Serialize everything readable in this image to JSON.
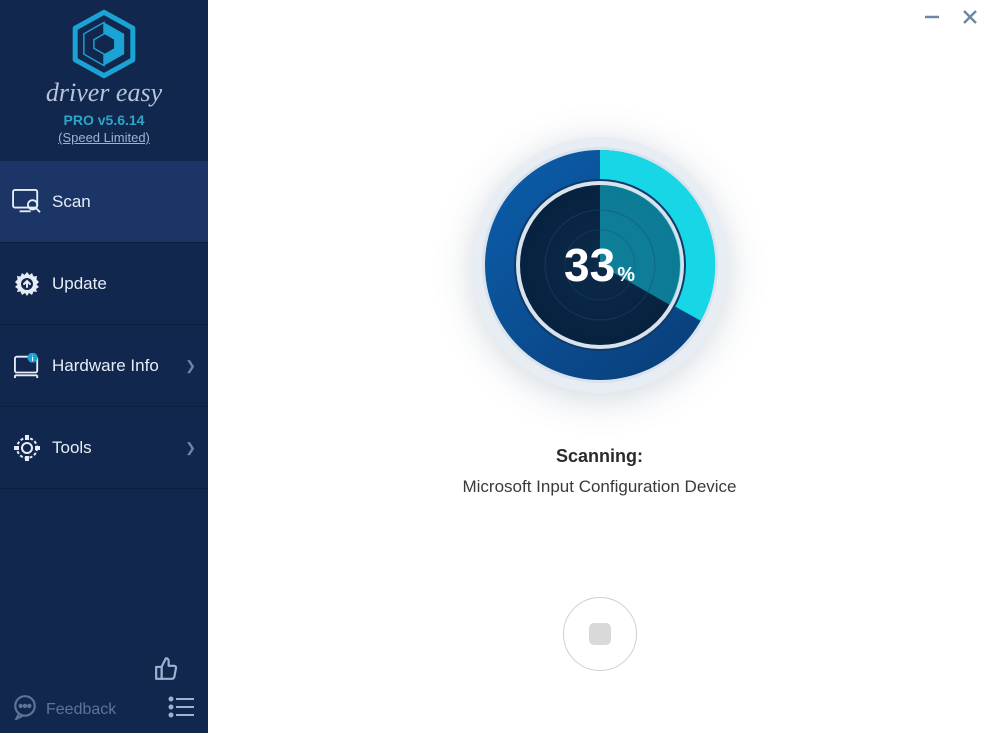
{
  "brand": "driver easy",
  "version": "PRO v5.6.14",
  "speed_limited": "(Speed Limited)",
  "nav": {
    "scan": "Scan",
    "update": "Update",
    "hardware_info": "Hardware Info",
    "tools": "Tools"
  },
  "footer": {
    "feedback": "Feedback"
  },
  "scan": {
    "progress_value": "33",
    "progress_unit": "%",
    "status_heading": "Scanning:",
    "status_detail": "Microsoft Input Configuration Device"
  }
}
